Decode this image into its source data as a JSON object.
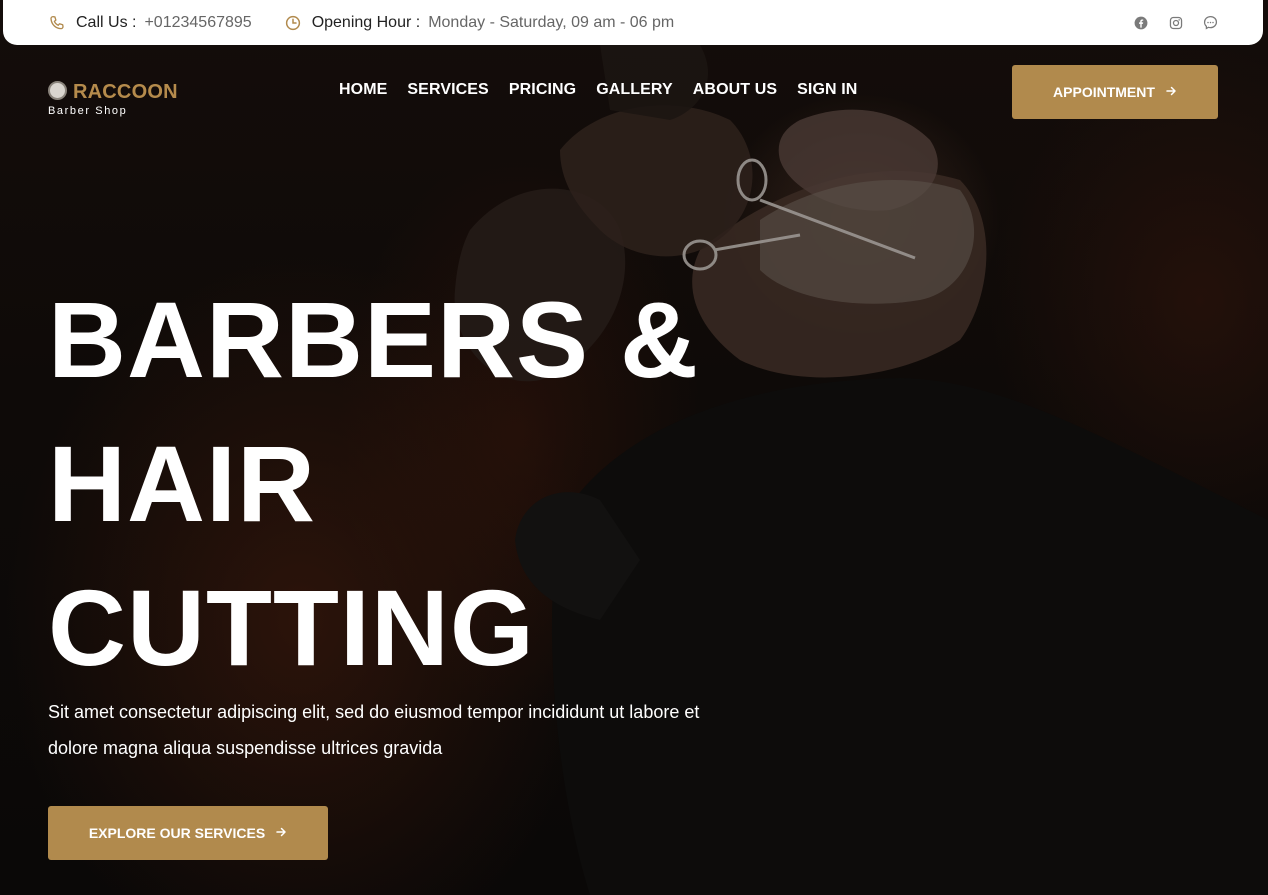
{
  "topbar": {
    "call_label": "Call Us :",
    "call_value": "+01234567895",
    "hours_label": "Opening Hour :",
    "hours_value": "Monday - Saturday, 09 am - 06 pm",
    "socials": [
      "facebook-icon",
      "instagram-icon",
      "messenger-icon"
    ]
  },
  "brand": {
    "name": "RACCOON",
    "tagline": "Barber Shop",
    "accent_color": "#b18a4d"
  },
  "nav": {
    "items": [
      "HOME",
      "SERVICES",
      "PRICING",
      "GALLERY",
      "ABOUT US",
      "SIGN IN"
    ],
    "cta_label": "APPOINTMENT",
    "cta_icon": "arrow-right-icon"
  },
  "hero": {
    "title_lines": [
      "BARBERS &",
      "HAIR",
      "CUTTING"
    ],
    "description": "Sit amet consectetur adipiscing elit, sed do eiusmod tempor incididunt ut labore et dolore magna aliqua suspendisse ultrices gravida",
    "button_label": "EXPLORE OUR SERVICES",
    "button_icon": "arrow-right-icon"
  }
}
